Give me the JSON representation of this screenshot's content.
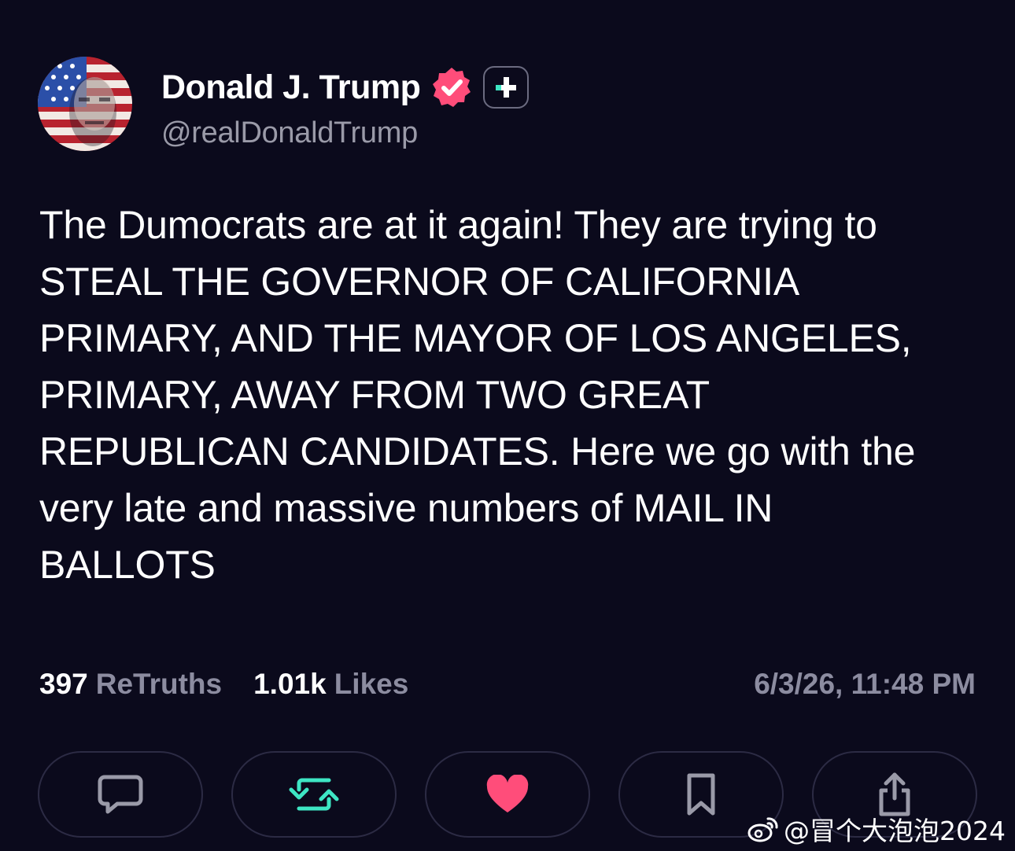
{
  "author": {
    "display_name": "Donald J. Trump",
    "handle": "@realDonaldTrump",
    "verified_badge_color": "#ff4d7a",
    "avatar_icon": "flag-portrait-avatar"
  },
  "post": {
    "text": "The Dumocrats are at it again! They are trying to\nSTEAL THE GOVERNOR OF CALIFORNIA\nPRIMARY, AND THE MAYOR OF LOS ANGELES,\nPRIMARY, AWAY FROM TWO GREAT\nREPUBLICAN CANDIDATES. Here we go with the\nvery late and massive numbers of MAIL IN\nBALLOTS"
  },
  "stats": {
    "retruths_count": "397",
    "retruths_label": "ReTruths",
    "likes_count": "1.01k",
    "likes_label": "Likes",
    "timestamp": "6/3/26, 11:48 PM"
  },
  "actions": [
    {
      "icon": "reply-icon",
      "color": "#9a9aa8"
    },
    {
      "icon": "retruth-icon",
      "color": "#3ee6c4"
    },
    {
      "icon": "heart-icon",
      "color": "#ff4d7a"
    },
    {
      "icon": "bookmark-icon",
      "color": "#9a9aa8"
    },
    {
      "icon": "share-icon",
      "color": "#9a9aa8"
    }
  ],
  "watermark": {
    "text": "@冒个大泡泡2024",
    "icon": "weibo-icon"
  }
}
